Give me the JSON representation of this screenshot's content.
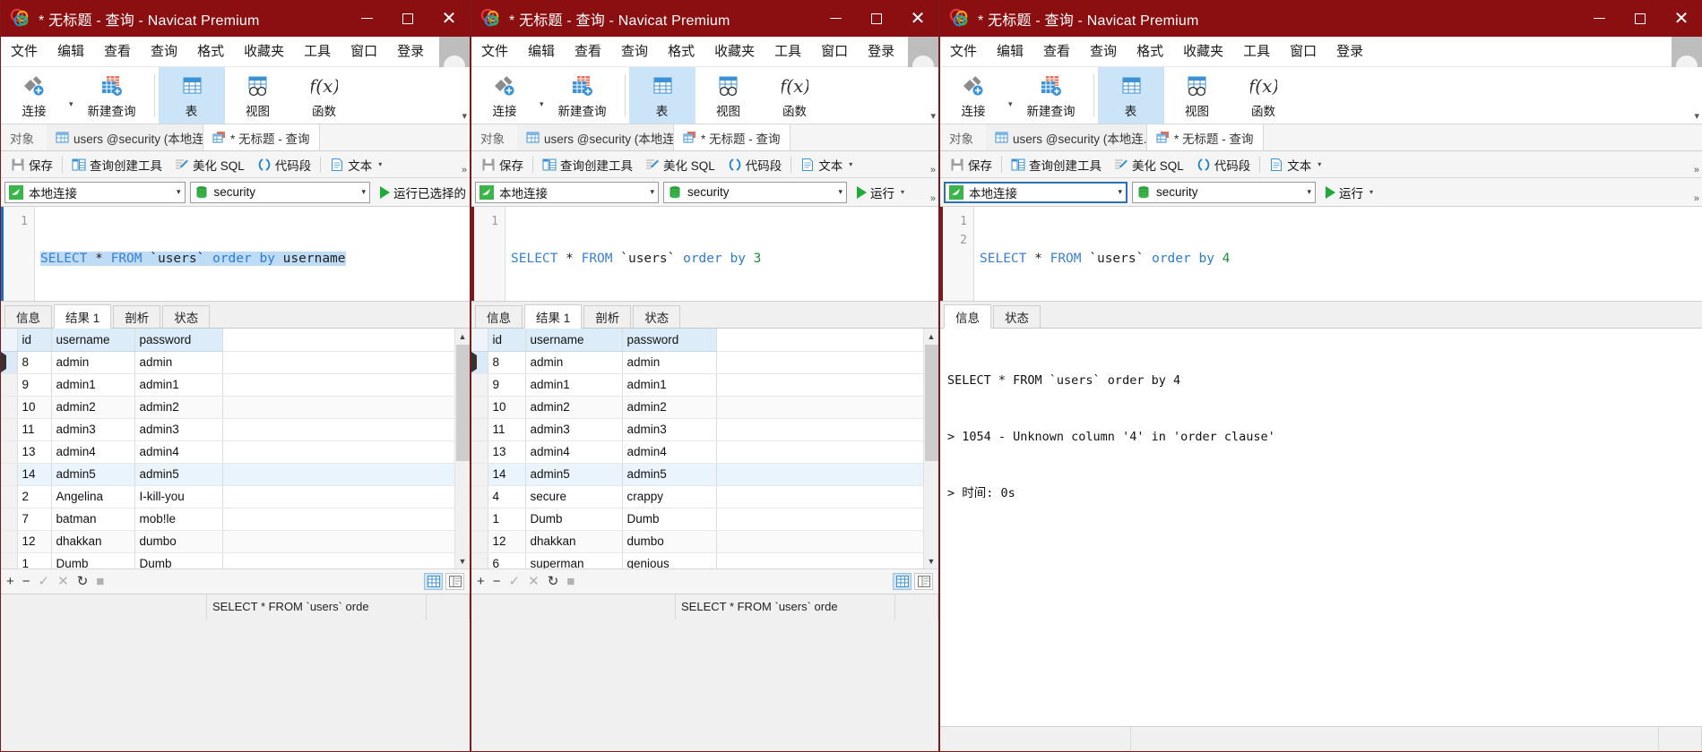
{
  "app": {
    "name": "Navicat Premium",
    "logo_icon": "navicat-logo-icon"
  },
  "windows": [
    {
      "id": "window-1",
      "title": "* 无标题 - 查询 - Navicat Premium",
      "titlebar": {
        "minimize_label": "–",
        "maximize_label": "□",
        "close_label": "✕"
      },
      "menu": [
        "文件",
        "编辑",
        "查看",
        "查询",
        "格式",
        "收藏夹",
        "工具",
        "窗口",
        "登录"
      ],
      "menu_overflow": "»",
      "toolbar": [
        {
          "label": "连接",
          "icon": "connection-plus-icon",
          "active": false,
          "has_caret": true
        },
        {
          "label": "新建查询",
          "icon": "new-query-icon",
          "active": false,
          "has_caret": false
        },
        {
          "label": "表",
          "icon": "table-icon",
          "active": true,
          "has_caret": false
        },
        {
          "label": "视图",
          "icon": "view-icon",
          "active": false,
          "has_caret": false
        },
        {
          "label": "函数",
          "icon": "function-icon",
          "active": false,
          "has_caret": false
        }
      ],
      "toolbar_overflow": "▾",
      "object_tabs": [
        {
          "label": "对象",
          "icon": "",
          "active": false,
          "plain": true
        },
        {
          "label": "users @security (本地连...",
          "icon": "table-tab-icon",
          "active": false,
          "plain": false
        },
        {
          "label": "* 无标题 - 查询",
          "icon": "query-tab-icon",
          "active": true,
          "plain": false
        }
      ],
      "toolbar2": [
        {
          "label": "保存",
          "icon": "save-icon",
          "caret": false
        },
        {
          "label": "查询创建工具",
          "icon": "query-builder-icon",
          "caret": false
        },
        {
          "label": "美化 SQL",
          "icon": "beautify-sql-icon",
          "caret": false
        },
        {
          "label": "代码段",
          "icon": "code-snippet-icon",
          "caret": false
        },
        {
          "label": "文本",
          "icon": "text-icon",
          "caret": true
        }
      ],
      "toolbar2_overflow": "»",
      "connection": {
        "connection_value": "本地连接",
        "connection_icon": "mysql-dolphin-icon",
        "database_value": "security",
        "database_icon": "database-icon",
        "run_label": "运行已选择的",
        "run_icon": "play-icon",
        "run_caret": false
      },
      "editor": {
        "line_numbers": [
          "1"
        ],
        "sql_tokens": [
          {
            "t": "SELECT",
            "c": "kw"
          },
          {
            "t": " * ",
            "c": "ident"
          },
          {
            "t": "FROM",
            "c": "kw"
          },
          {
            "t": " `users` ",
            "c": "ident"
          },
          {
            "t": "order by",
            "c": "kw2"
          },
          {
            "t": " username",
            "c": "ident"
          }
        ],
        "sql_plain": "SELECT * FROM `users` order by username",
        "selected": true
      },
      "result_tabs": [
        {
          "label": "信息",
          "active": false
        },
        {
          "label": "结果 1",
          "active": true
        },
        {
          "label": "剖析",
          "active": false
        },
        {
          "label": "状态",
          "active": false
        }
      ],
      "grid": {
        "columns": [
          "id",
          "username",
          "password"
        ],
        "rows": [
          {
            "id": "8",
            "username": "admin",
            "password": "admin",
            "current": true
          },
          {
            "id": "9",
            "username": "admin1",
            "password": "admin1",
            "current": false
          },
          {
            "id": "10",
            "username": "admin2",
            "password": "admin2",
            "current": false
          },
          {
            "id": "11",
            "username": "admin3",
            "password": "admin3",
            "current": false
          },
          {
            "id": "13",
            "username": "admin4",
            "password": "admin4",
            "current": false
          },
          {
            "id": "14",
            "username": "admin5",
            "password": "admin5",
            "current": false
          },
          {
            "id": "2",
            "username": "Angelina",
            "password": "I-kill-you",
            "current": false
          },
          {
            "id": "7",
            "username": "batman",
            "password": "mob!le",
            "current": false
          },
          {
            "id": "12",
            "username": "dhakkan",
            "password": "dumbo",
            "current": false
          },
          {
            "id": "1",
            "username": "Dumb",
            "password": "Dumb",
            "current": false
          }
        ]
      },
      "action_bar": {
        "add": "+",
        "remove": "−",
        "confirm": "✓",
        "cancel": "✕",
        "refresh": "↻",
        "stop": "■",
        "grid_view_icon": "grid-view-icon",
        "form_view_icon": "form-view-icon"
      },
      "status_bar": {
        "left": "",
        "sql": "SELECT * FROM `users` orde",
        "right": ""
      },
      "has_result_grid": true
    },
    {
      "id": "window-2",
      "title": "* 无标题 - 查询 - Navicat Premium",
      "titlebar": {
        "minimize_label": "–",
        "maximize_label": "□",
        "close_label": "✕"
      },
      "menu": [
        "文件",
        "编辑",
        "查看",
        "查询",
        "格式",
        "收藏夹",
        "工具",
        "窗口",
        "登录"
      ],
      "menu_overflow": "»",
      "toolbar": [
        {
          "label": "连接",
          "icon": "connection-plus-icon",
          "active": false,
          "has_caret": true
        },
        {
          "label": "新建查询",
          "icon": "new-query-icon",
          "active": false,
          "has_caret": false
        },
        {
          "label": "表",
          "icon": "table-icon",
          "active": true,
          "has_caret": false
        },
        {
          "label": "视图",
          "icon": "view-icon",
          "active": false,
          "has_caret": false
        },
        {
          "label": "函数",
          "icon": "function-icon",
          "active": false,
          "has_caret": false
        }
      ],
      "toolbar_overflow": "▾",
      "object_tabs": [
        {
          "label": "对象",
          "icon": "",
          "active": false,
          "plain": true
        },
        {
          "label": "users @security (本地连...",
          "icon": "table-tab-icon",
          "active": false,
          "plain": false
        },
        {
          "label": "* 无标题 - 查询",
          "icon": "query-tab-icon",
          "active": true,
          "plain": false
        }
      ],
      "toolbar2": [
        {
          "label": "保存",
          "icon": "save-icon",
          "caret": false
        },
        {
          "label": "查询创建工具",
          "icon": "query-builder-icon",
          "caret": false
        },
        {
          "label": "美化 SQL",
          "icon": "beautify-sql-icon",
          "caret": false
        },
        {
          "label": "代码段",
          "icon": "code-snippet-icon",
          "caret": false
        },
        {
          "label": "文本",
          "icon": "text-icon",
          "caret": true
        }
      ],
      "toolbar2_overflow": "»",
      "connection": {
        "connection_value": "本地连接",
        "connection_icon": "mysql-dolphin-icon",
        "database_value": "security",
        "database_icon": "database-icon",
        "run_label": "运行",
        "run_icon": "play-icon",
        "run_caret": true
      },
      "editor": {
        "line_numbers": [
          "1"
        ],
        "sql_tokens": [
          {
            "t": "SELECT",
            "c": "kw"
          },
          {
            "t": " * ",
            "c": "ident"
          },
          {
            "t": "FROM",
            "c": "kw"
          },
          {
            "t": " `users` ",
            "c": "ident"
          },
          {
            "t": "order by",
            "c": "kw2"
          },
          {
            "t": " ",
            "c": "ident"
          },
          {
            "t": "3",
            "c": "num"
          }
        ],
        "sql_plain": "SELECT * FROM `users` order by 3",
        "selected": false
      },
      "result_tabs": [
        {
          "label": "信息",
          "active": false
        },
        {
          "label": "结果 1",
          "active": true
        },
        {
          "label": "剖析",
          "active": false
        },
        {
          "label": "状态",
          "active": false
        }
      ],
      "grid": {
        "columns": [
          "id",
          "username",
          "password"
        ],
        "rows": [
          {
            "id": "8",
            "username": "admin",
            "password": "admin",
            "current": true
          },
          {
            "id": "9",
            "username": "admin1",
            "password": "admin1",
            "current": false
          },
          {
            "id": "10",
            "username": "admin2",
            "password": "admin2",
            "current": false
          },
          {
            "id": "11",
            "username": "admin3",
            "password": "admin3",
            "current": false
          },
          {
            "id": "13",
            "username": "admin4",
            "password": "admin4",
            "current": false
          },
          {
            "id": "14",
            "username": "admin5",
            "password": "admin5",
            "current": false
          },
          {
            "id": "4",
            "username": "secure",
            "password": "crappy",
            "current": false
          },
          {
            "id": "1",
            "username": "Dumb",
            "password": "Dumb",
            "current": false
          },
          {
            "id": "12",
            "username": "dhakkan",
            "password": "dumbo",
            "current": false
          },
          {
            "id": "6",
            "username": "superman",
            "password": "genious",
            "current": false
          }
        ]
      },
      "action_bar": {
        "add": "+",
        "remove": "−",
        "confirm": "✓",
        "cancel": "✕",
        "refresh": "↻",
        "stop": "■",
        "grid_view_icon": "grid-view-icon",
        "form_view_icon": "form-view-icon"
      },
      "status_bar": {
        "left": "",
        "sql": "SELECT * FROM `users` orde",
        "right": ""
      },
      "has_result_grid": true
    },
    {
      "id": "window-3",
      "title": "* 无标题 - 查询 - Navicat Premium",
      "titlebar": {
        "minimize_label": "–",
        "maximize_label": "□",
        "close_label": "✕"
      },
      "menu": [
        "文件",
        "编辑",
        "查看",
        "查询",
        "格式",
        "收藏夹",
        "工具",
        "窗口",
        "登录"
      ],
      "menu_overflow": "»",
      "toolbar": [
        {
          "label": "连接",
          "icon": "connection-plus-icon",
          "active": false,
          "has_caret": true
        },
        {
          "label": "新建查询",
          "icon": "new-query-icon",
          "active": false,
          "has_caret": false
        },
        {
          "label": "表",
          "icon": "table-icon",
          "active": true,
          "has_caret": false
        },
        {
          "label": "视图",
          "icon": "view-icon",
          "active": false,
          "has_caret": false
        },
        {
          "label": "函数",
          "icon": "function-icon",
          "active": false,
          "has_caret": false
        }
      ],
      "toolbar_overflow": "▾",
      "object_tabs": [
        {
          "label": "对象",
          "icon": "",
          "active": false,
          "plain": true
        },
        {
          "label": "users @security (本地连...",
          "icon": "table-tab-icon",
          "active": false,
          "plain": false
        },
        {
          "label": "* 无标题 - 查询",
          "icon": "query-tab-icon",
          "active": true,
          "plain": false
        }
      ],
      "toolbar2": [
        {
          "label": "保存",
          "icon": "save-icon",
          "caret": false
        },
        {
          "label": "查询创建工具",
          "icon": "query-builder-icon",
          "caret": false
        },
        {
          "label": "美化 SQL",
          "icon": "beautify-sql-icon",
          "caret": false
        },
        {
          "label": "代码段",
          "icon": "code-snippet-icon",
          "caret": false
        },
        {
          "label": "文本",
          "icon": "text-icon",
          "caret": true
        }
      ],
      "toolbar2_overflow": "»",
      "connection": {
        "connection_value": "本地连接",
        "connection_icon": "mysql-dolphin-icon",
        "database_value": "security",
        "database_icon": "database-icon",
        "run_label": "运行",
        "run_icon": "play-icon",
        "run_caret": true
      },
      "editor": {
        "line_numbers": [
          "1",
          "2"
        ],
        "sql_tokens": [
          {
            "t": "SELECT",
            "c": "kw"
          },
          {
            "t": " * ",
            "c": "ident"
          },
          {
            "t": "FROM",
            "c": "kw"
          },
          {
            "t": " `users` ",
            "c": "ident"
          },
          {
            "t": "order by",
            "c": "kw2"
          },
          {
            "t": " ",
            "c": "ident"
          },
          {
            "t": "4",
            "c": "num"
          }
        ],
        "sql_plain": "SELECT * FROM `users` order by 4",
        "selected": false
      },
      "result_tabs": [
        {
          "label": "信息",
          "active": true
        },
        {
          "label": "状态",
          "active": false
        }
      ],
      "message_lines": [
        "SELECT * FROM `users` order by 4",
        "> 1054 - Unknown column '4' in 'order clause'",
        "> 时间: 0s"
      ],
      "status_bar": {
        "left": "",
        "sql": "",
        "right": ""
      },
      "has_result_grid": false
    }
  ]
}
